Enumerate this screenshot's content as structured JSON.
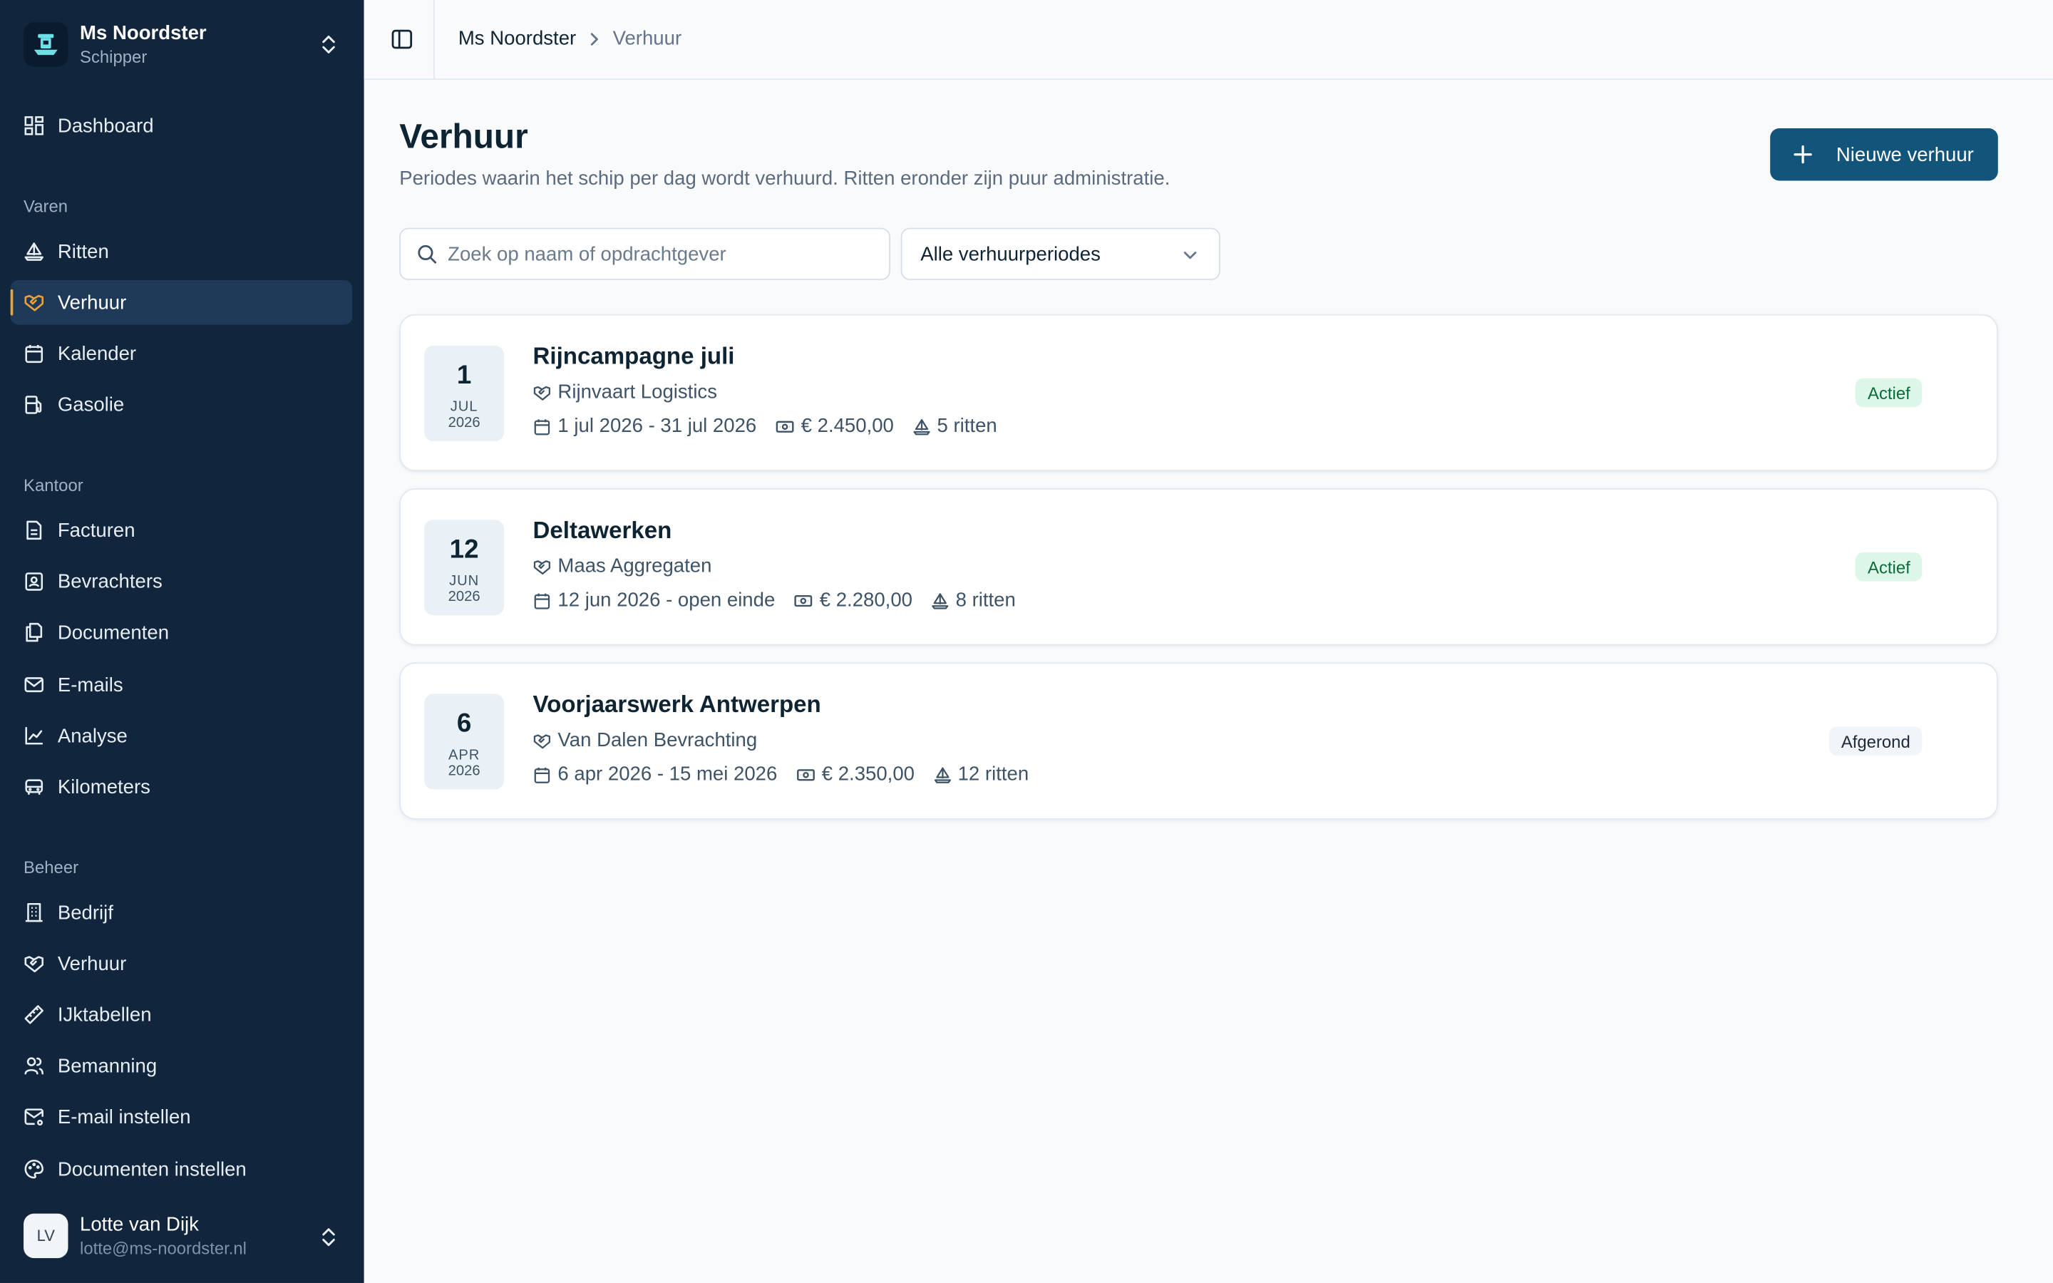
{
  "ship": {
    "name": "Ms Noordster",
    "role": "Schipper"
  },
  "nav": {
    "dashboard": "Dashboard",
    "sections": {
      "varen": "Varen",
      "kantoor": "Kantoor",
      "beheer": "Beheer"
    },
    "varen_items": [
      {
        "label": "Ritten",
        "icon": "boat-icon"
      },
      {
        "label": "Verhuur",
        "icon": "handshake-icon",
        "active": true
      },
      {
        "label": "Kalender",
        "icon": "calendar-icon"
      },
      {
        "label": "Gasolie",
        "icon": "fuel-icon"
      }
    ],
    "kantoor_items": [
      {
        "label": "Facturen",
        "icon": "file-icon"
      },
      {
        "label": "Bevrachters",
        "icon": "contact-icon"
      },
      {
        "label": "Documenten",
        "icon": "files-icon"
      },
      {
        "label": "E-mails",
        "icon": "mail-icon"
      },
      {
        "label": "Analyse",
        "icon": "chart-icon"
      },
      {
        "label": "Kilometers",
        "icon": "car-icon"
      }
    ],
    "beheer_items": [
      {
        "label": "Bedrijf",
        "icon": "building-icon"
      },
      {
        "label": "Verhuur",
        "icon": "handshake-icon"
      },
      {
        "label": "IJktabellen",
        "icon": "ruler-icon"
      },
      {
        "label": "Bemanning",
        "icon": "users-icon"
      },
      {
        "label": "E-mail instellen",
        "icon": "mail-settings-icon"
      },
      {
        "label": "Documenten instellen",
        "icon": "palette-icon"
      }
    ]
  },
  "user": {
    "initials": "LV",
    "name": "Lotte van Dijk",
    "email": "lotte@ms-noordster.nl"
  },
  "breadcrumb": {
    "parent": "Ms Noordster",
    "current": "Verhuur"
  },
  "page": {
    "title": "Verhuur",
    "subtitle": "Periodes waarin het schip per dag wordt verhuurd. Ritten eronder zijn puur administratie.",
    "new_button": "Nieuwe verhuur"
  },
  "filters": {
    "search_placeholder": "Zoek op naam of opdrachtgever",
    "search_value": "",
    "period_select": "Alle verhuurperiodes"
  },
  "rentals": [
    {
      "day": "1",
      "month": "JUL",
      "year": "2026",
      "title": "Rijncampagne juli",
      "client": "Rijnvaart Logistics",
      "period": "1 jul 2026 - 31 jul 2026",
      "amount": "€ 2.450,00",
      "trips": "5 ritten",
      "status": "Actief",
      "status_color": "#dcf7e8"
    },
    {
      "day": "12",
      "month": "JUN",
      "year": "2026",
      "title": "Deltawerken",
      "client": "Maas Aggregaten",
      "period": "12 jun 2026 - open einde",
      "amount": "€ 2.280,00",
      "trips": "8 ritten",
      "status": "Actief",
      "status_color": "#dcf7e8"
    },
    {
      "day": "6",
      "month": "APR",
      "year": "2026",
      "title": "Voorjaarswerk Antwerpen",
      "client": "Van Dalen Bevrachting",
      "period": "6 apr 2026 - 15 mei 2026",
      "amount": "€ 2.350,00",
      "trips": "12 ritten",
      "status": "Afgerond",
      "status_color": "#f1f5f9"
    }
  ],
  "colors": {
    "sidebar": "#11253d",
    "accent": "#13547a",
    "active_marker": "#e8a33c"
  }
}
